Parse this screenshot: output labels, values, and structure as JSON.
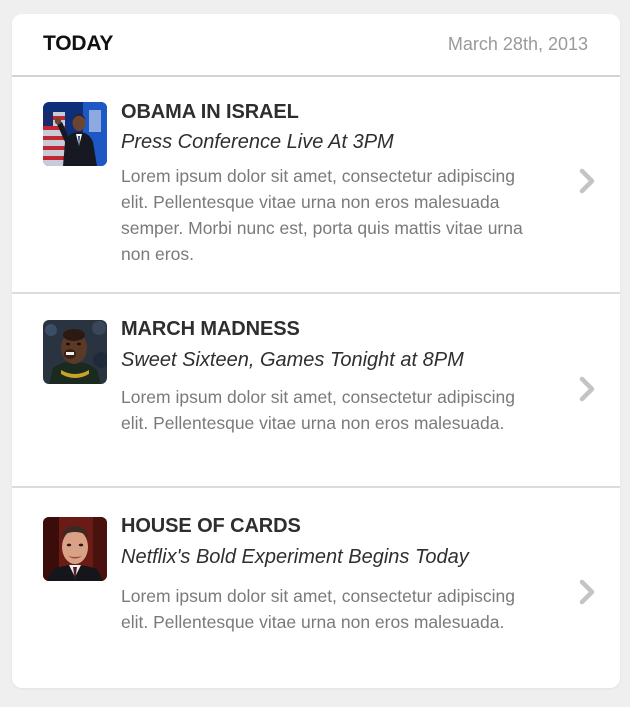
{
  "header": {
    "title": "TODAY",
    "date": "March 28th, 2013"
  },
  "stories": [
    {
      "title": "OBAMA IN ISRAEL",
      "subtitle": "Press Conference Live At 3PM",
      "body": "Lorem ipsum dolor sit amet, consectetur adipiscing elit. Pellentesque vitae urna non eros malesuada semper. Morbi nunc est, porta quis mattis vitae urna non eros.",
      "thumb_icon": "obama-photo",
      "chevron_icon": "chevron-right-icon"
    },
    {
      "title": "MARCH MADNESS",
      "subtitle": "Sweet Sixteen, Games Tonight at 8PM",
      "body": "Lorem ipsum dolor sit amet, consectetur adipiscing elit. Pellentesque vitae urna non eros malesuada.",
      "thumb_icon": "basketball-player-photo",
      "chevron_icon": "chevron-right-icon"
    },
    {
      "title": "HOUSE OF CARDS",
      "subtitle": "Netflix's Bold Experiment Begins Today",
      "body": "Lorem ipsum dolor sit amet, consectetur adipiscing elit. Pellentesque vitae urna non eros malesuada.",
      "thumb_icon": "kevin-spacey-photo",
      "chevron_icon": "chevron-right-icon"
    }
  ],
  "colors": {
    "background": "#efefef",
    "card": "#ffffff",
    "divider": "#dcdcdc",
    "title": "#2e2e2e",
    "body": "#7a7a7a",
    "date": "#9a9a9a",
    "chevron": "#c4c4c4"
  }
}
